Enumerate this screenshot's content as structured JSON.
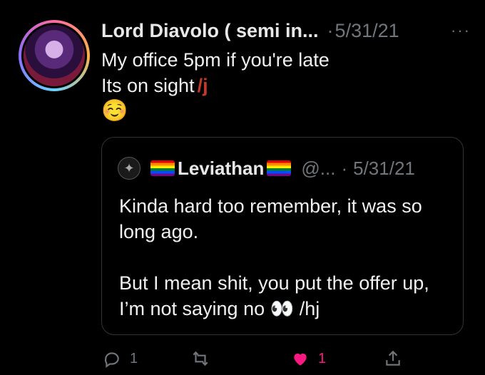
{
  "tweet": {
    "author_name": "Lord Diavolo ( semi in...",
    "dot": "·",
    "date": "5/31/21",
    "more_label": "···",
    "line1": "My office 5pm if you're late",
    "line2": "Its on sight",
    "scribble": "/j",
    "emoji": "☺️"
  },
  "quote": {
    "author_name": "Leviathan",
    "handle": "@...",
    "dot": "·",
    "date": "5/31/21",
    "para1": "Kinda hard too remember, it was so long ago.",
    "para2": "But I mean shit, you put the offer up, I’m not saying no 👀 /hj"
  },
  "actions": {
    "reply_count": "1",
    "like_count": "1"
  },
  "colors": {
    "background": "#000000",
    "muted": "#71767b",
    "like": "#f91880",
    "border": "#2f3336"
  }
}
